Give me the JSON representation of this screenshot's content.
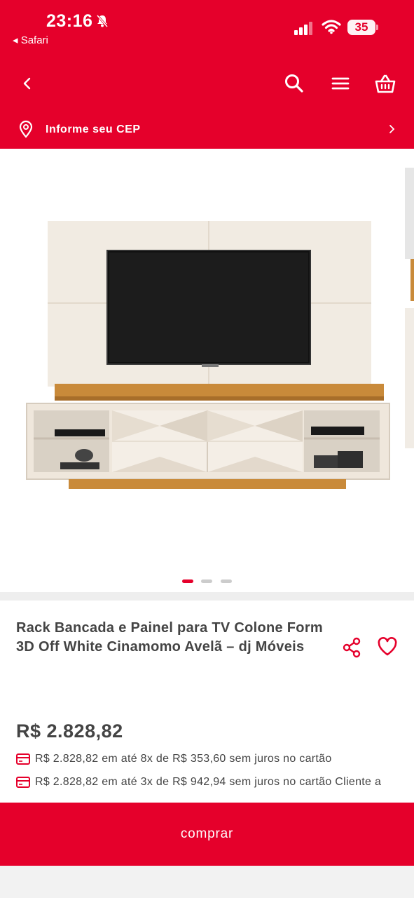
{
  "status_bar": {
    "time": "23:16",
    "back_app": "◂ Safari",
    "battery": "35"
  },
  "header": {
    "cep_label": "Informe seu CEP"
  },
  "gallery": {
    "image_count": 3,
    "active_index": 0
  },
  "product": {
    "title": "Rack Bancada e Painel para TV Colone Form 3D Off White Cinamomo Avelã – dj Móveis",
    "price": "R$ 2.828,82",
    "installments": [
      "R$ 2.828,82 em até 8x de R$ 353,60 sem juros no cartão",
      "R$ 2.828,82 em até 3x de R$ 942,94 sem juros no cartão Cliente a"
    ]
  },
  "actions": {
    "buy_label": "comprar"
  },
  "colors": {
    "brand": "#e5002b",
    "text": "#444444"
  }
}
